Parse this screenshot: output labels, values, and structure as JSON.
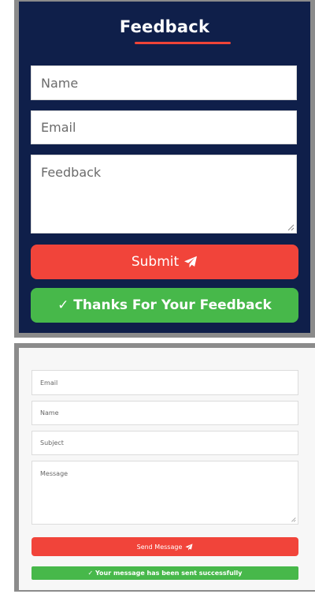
{
  "feedback_form": {
    "title": "Feedback",
    "name_placeholder": "Name",
    "email_placeholder": "Email",
    "feedback_placeholder": "Feedback",
    "submit_label": "Submit",
    "submit_icon": "paper-plane-icon",
    "success_message": "✓ Thanks For Your Feedback",
    "colors": {
      "background": "#0f1f4a",
      "accent": "#f1443a",
      "success": "#47b84a"
    }
  },
  "contact_form": {
    "email_placeholder": "Email",
    "name_placeholder": "Name",
    "subject_placeholder": "Subject",
    "message_placeholder": "Message",
    "send_label": "Send Message",
    "send_icon": "paper-plane-icon",
    "success_message": "✓ Your message has been sent successfully",
    "colors": {
      "background": "#f7f7f7",
      "accent": "#f1443a",
      "success": "#47b84a"
    }
  }
}
